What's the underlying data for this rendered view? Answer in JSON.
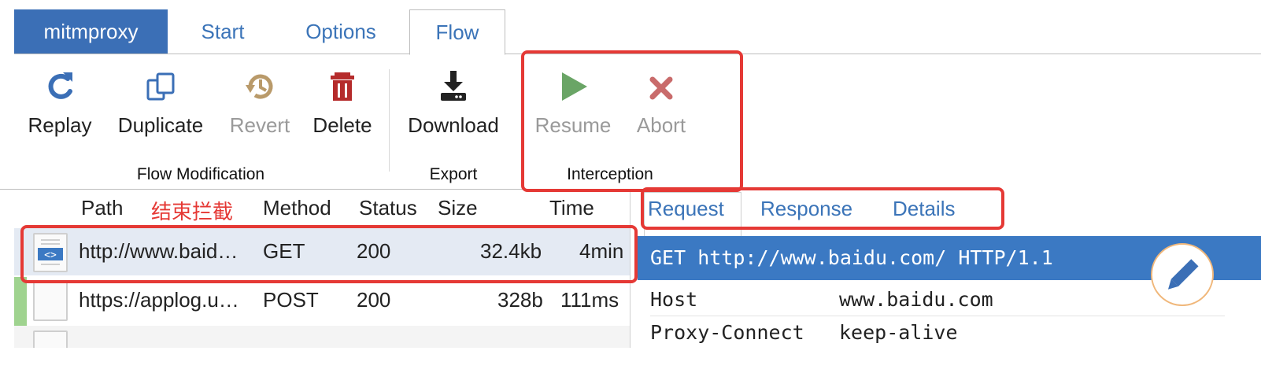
{
  "tabs": {
    "brand": "mitmproxy",
    "start": "Start",
    "options": "Options",
    "flow": "Flow"
  },
  "toolbar": {
    "replay": "Replay",
    "duplicate": "Duplicate",
    "revert": "Revert",
    "delete": "Delete",
    "download": "Download",
    "resume": "Resume",
    "abort": "Abort",
    "groups": {
      "flow_modification": "Flow Modification",
      "export": "Export",
      "interception": "Interception"
    }
  },
  "flow_list": {
    "headers": {
      "path": "Path",
      "annotation": "结束拦截",
      "method": "Method",
      "status": "Status",
      "size": "Size",
      "time": "Time"
    },
    "rows": [
      {
        "path": "http://www.baid…",
        "method": "GET",
        "status": "200",
        "size": "32.4kb",
        "time": "4min"
      },
      {
        "path": "https://applog.u…",
        "method": "POST",
        "status": "200",
        "size": "328b",
        "time": "111ms"
      }
    ]
  },
  "detail": {
    "tabs": {
      "request": "Request",
      "response": "Response",
      "details": "Details"
    },
    "request_line": "GET http://www.baidu.com/ HTTP/1.1",
    "headers": [
      {
        "name": "Host",
        "value": "www.baidu.com"
      },
      {
        "name": "Proxy-Connect",
        "value": "keep-alive"
      }
    ]
  },
  "colors": {
    "accent": "#3b6fb6",
    "highlight_row": "#e4eaf3",
    "annotation": "#e53935",
    "delete_icon": "#b52b2b",
    "resume_icon": "#6aa566",
    "abort_icon": "#c96b6b"
  },
  "icons": {
    "replay": "refresh-icon",
    "duplicate": "copy-icon",
    "revert": "history-icon",
    "delete": "trash-icon",
    "download": "download-icon",
    "resume": "play-icon",
    "abort": "close-icon",
    "edit": "pencil-icon"
  }
}
